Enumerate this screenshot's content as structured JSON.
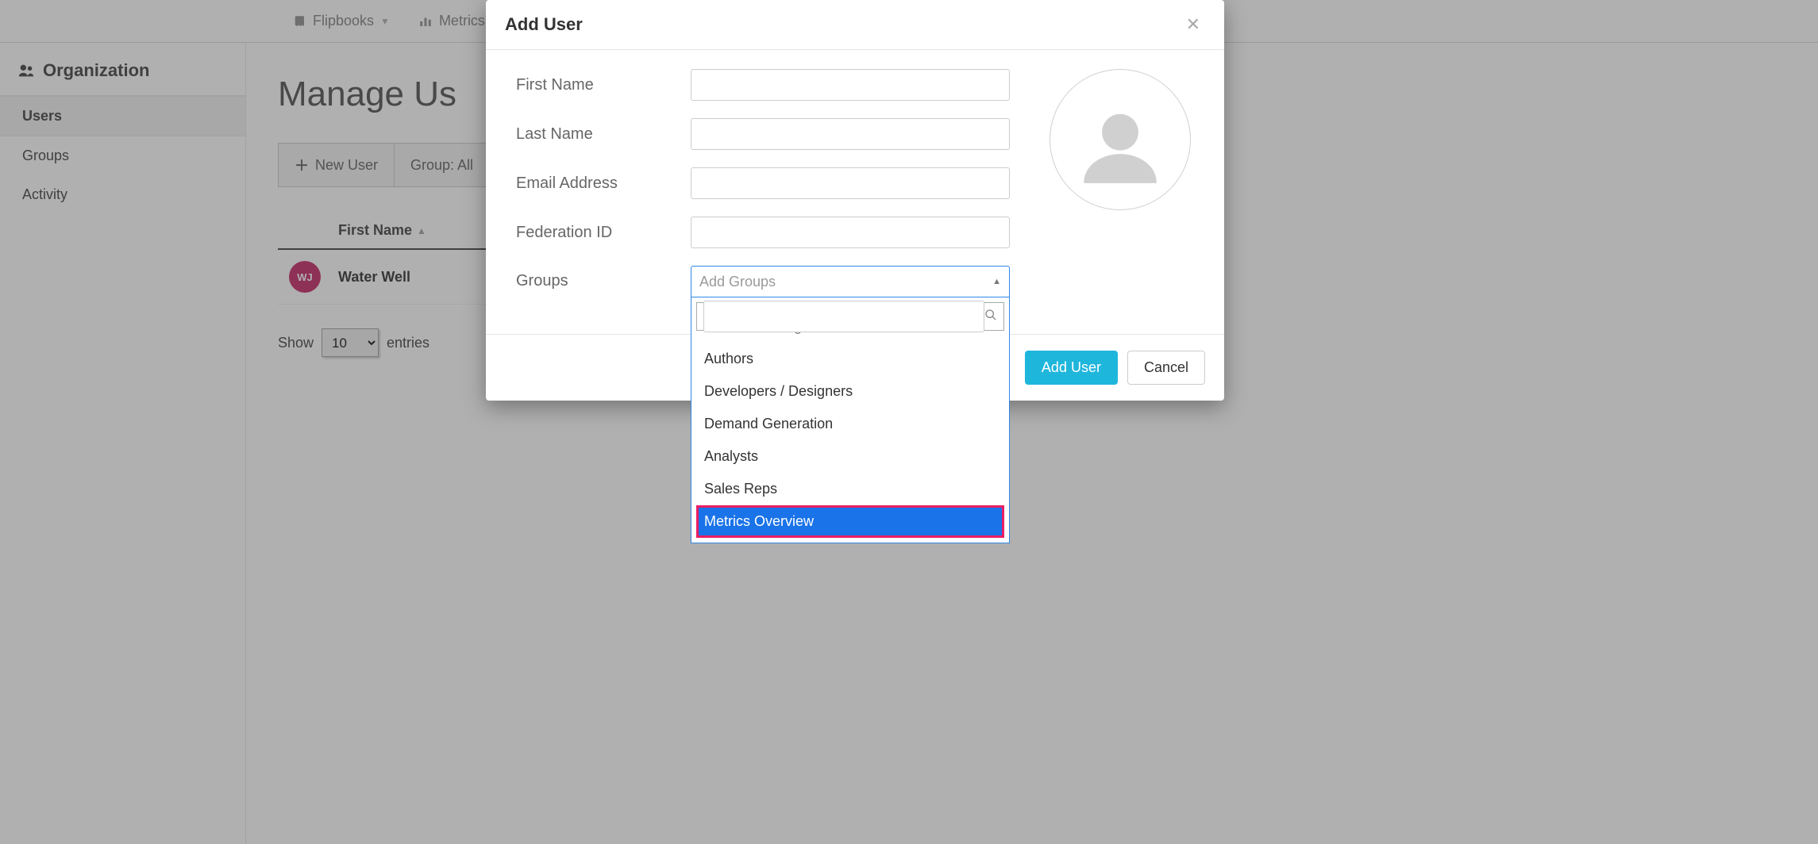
{
  "topnav": {
    "flipbooks": "Flipbooks",
    "metrics": "Metrics"
  },
  "sidebar": {
    "heading": "Organization",
    "items": [
      "Users",
      "Groups",
      "Activity"
    ],
    "active_index": 0
  },
  "main": {
    "title": "Manage Us",
    "toolbar": {
      "new_user": "New User",
      "group_filter": "Group: All"
    },
    "table": {
      "columns": {
        "first_name": "First Name"
      },
      "rows": [
        {
          "initials": "WJ",
          "first_name": "Water Well"
        }
      ]
    },
    "pager": {
      "show_label": "Show",
      "entries_label": "entries",
      "page_size": "10"
    }
  },
  "modal": {
    "title": "Add User",
    "fields": {
      "first_name_label": "First Name",
      "last_name_label": "Last Name",
      "email_label": "Email Address",
      "federation_id_label": "Federation ID",
      "groups_label": "Groups"
    },
    "groups": {
      "placeholder": "Add Groups",
      "search_value": "",
      "options": [
        "Content Managers",
        "Authors",
        "Developers / Designers",
        "Demand Generation",
        "Analysts",
        "Sales Reps",
        "Metrics Overview"
      ],
      "highlighted_index": 6
    },
    "footer": {
      "primary": "Add User",
      "cancel": "Cancel"
    }
  }
}
